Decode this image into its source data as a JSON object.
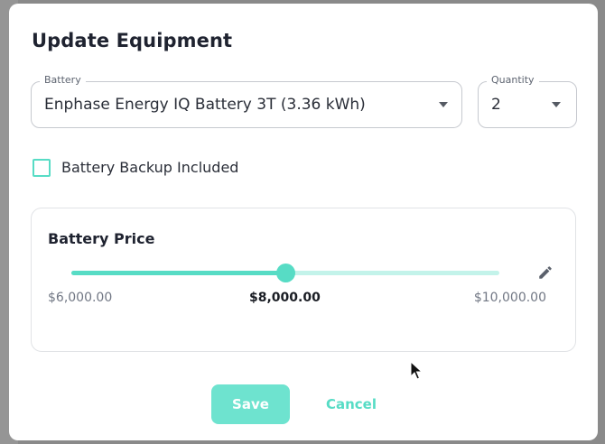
{
  "modal": {
    "title": "Update Equipment"
  },
  "battery_select": {
    "label": "Battery",
    "value": "Enphase Energy IQ Battery 3T (3.36 kWh)",
    "icon": "chevron-down-icon"
  },
  "quantity_select": {
    "label": "Quantity",
    "value": "2",
    "icon": "chevron-down-icon"
  },
  "backup_checkbox": {
    "label": "Battery Backup Included",
    "checked": false
  },
  "price": {
    "title": "Battery Price",
    "min_label": "$6,000.00",
    "max_label": "$10,000.00",
    "current_label": "$8,000.00",
    "min_value": 6000,
    "max_value": 10000,
    "current_value": 8000,
    "edit_icon": "pencil-icon"
  },
  "actions": {
    "save_label": "Save",
    "cancel_label": "Cancel"
  },
  "colors": {
    "accent": "#57dcc5",
    "accent_light": "#c3f3ea",
    "save_button": "#6ee3cf",
    "text_dark": "#1f2330",
    "text_muted": "#717784"
  }
}
